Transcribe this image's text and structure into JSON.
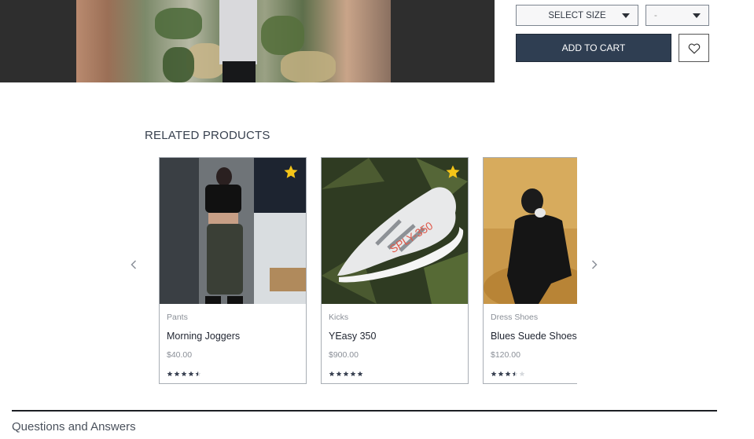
{
  "purchase": {
    "size_select_label": "SELECT SIZE",
    "quantity_select_value": "-",
    "add_to_cart_label": "ADD TO CART"
  },
  "related": {
    "title": "RELATED PRODUCTS",
    "products": [
      {
        "category": "Pants",
        "name": "Morning Joggers",
        "price": "$40.00",
        "rating": 4.5,
        "featured": true
      },
      {
        "category": "Kicks",
        "name": "YEasy 350",
        "price": "$900.00",
        "rating": 5,
        "featured": true
      },
      {
        "category": "Dress Shoes",
        "name": "Blues Suede Shoes",
        "price": "$120.00",
        "rating": 3.5,
        "featured": false
      }
    ]
  },
  "questions": {
    "title": "Questions and Answers"
  },
  "colors": {
    "primary": "#2f3e52",
    "star": "#f5c518",
    "rating_star": "#3a4252"
  },
  "icons": [
    "chevron-left-icon",
    "chevron-right-icon",
    "heart-icon",
    "star-icon",
    "caret-down-icon"
  ]
}
